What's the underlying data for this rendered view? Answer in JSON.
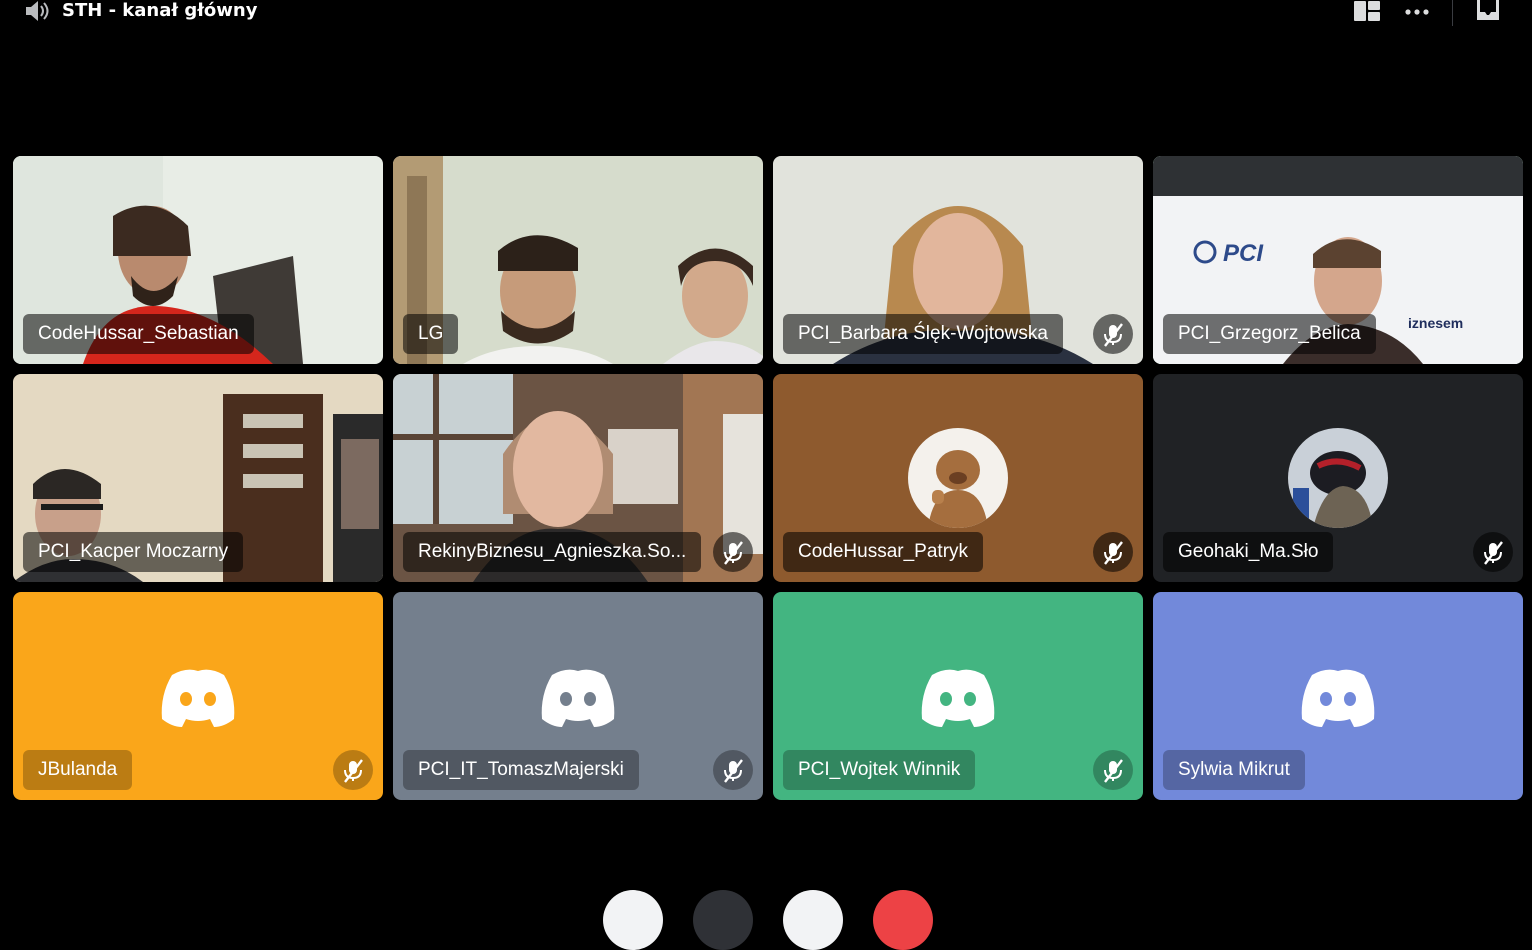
{
  "channel": {
    "title": "STH - kanał główny",
    "icon": "speaker-icon"
  },
  "toolbar": {
    "layout_icon": "grid-layout-icon",
    "more_icon": "more-dots-icon",
    "inbox_icon": "inbox-icon"
  },
  "colors": {
    "speaking_border": "#3ba55c",
    "jbulanda_bg": "#faa61a",
    "tomasz_bg": "#747f8d",
    "wojtek_bg": "#43b581",
    "sylwia_bg": "#7289da",
    "patryk_bg": "#8e5a2e",
    "geohaki_bg": "#202225"
  },
  "participants": [
    {
      "name": "CodeHussar_Sebastian",
      "muted": false,
      "media": "camera"
    },
    {
      "name": "LG",
      "muted": false,
      "media": "camera"
    },
    {
      "name": "PCI_Barbara Ślęk-Wojtowska",
      "muted": true,
      "media": "camera"
    },
    {
      "name": "PCI_Grzegorz_Belica",
      "muted": false,
      "media": "camera",
      "speaking": true
    },
    {
      "name": "PCI_Kacper Moczarny",
      "muted": false,
      "media": "camera"
    },
    {
      "name": "RekinyBiznesu_Agnieszka.So...",
      "muted": true,
      "media": "camera"
    },
    {
      "name": "CodeHussar_Patryk",
      "muted": true,
      "media": "avatar"
    },
    {
      "name": "Geohaki_Ma.Sło",
      "muted": true,
      "media": "avatar"
    },
    {
      "name": "JBulanda",
      "muted": true,
      "media": "default-avatar"
    },
    {
      "name": "PCI_IT_TomaszMajerski",
      "muted": true,
      "media": "default-avatar"
    },
    {
      "name": "PCI_Wojtek Winnik",
      "muted": true,
      "media": "default-avatar"
    },
    {
      "name": "Sylwia Mikrut",
      "muted": false,
      "media": "default-avatar"
    }
  ],
  "bottom_controls": [
    "camera-button",
    "screen-share-button",
    "mute-button",
    "disconnect-button"
  ]
}
